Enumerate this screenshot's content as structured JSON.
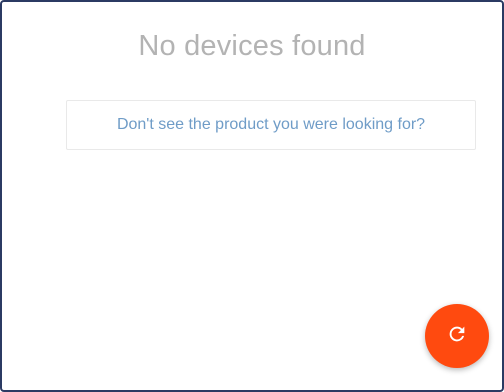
{
  "empty_state": {
    "title": "No devices found"
  },
  "help": {
    "link_text": "Don't see the product you were looking for?"
  },
  "fab": {
    "icon": "refresh-icon",
    "color": "#ff4a0f"
  },
  "colors": {
    "border": "#2b3a63",
    "title_text": "#b3b3b3",
    "link_text": "#6f9cc7"
  }
}
